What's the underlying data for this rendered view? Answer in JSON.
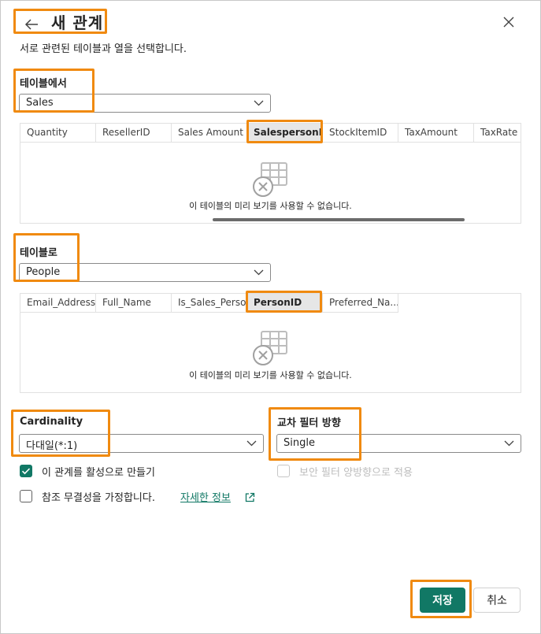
{
  "header": {
    "title": "새 관계",
    "subtitle": "서로 관련된 테이블과 열을 선택합니다."
  },
  "from_table": {
    "label": "테이블에서",
    "selected": "Sales",
    "columns": [
      "Quantity",
      "ResellerID",
      "Sales Amount",
      "SalespersonP...",
      "StockItemID",
      "TaxAmount",
      "TaxRate"
    ],
    "selected_column": "SalespersonP...",
    "empty_message": "이 테이블의 미리 보기를 사용할 수 없습니다."
  },
  "to_table": {
    "label": "테이블로",
    "selected": "People",
    "columns": [
      "Email_Address",
      "Full_Name",
      "Is_Sales_Person",
      "PersonID",
      "Preferred_Na..."
    ],
    "selected_column": "PersonID",
    "empty_message": "이 테이블의 미리 보기를 사용할 수 없습니다."
  },
  "cardinality": {
    "label": "Cardinality",
    "selected": "다대일(*:1)"
  },
  "cross_filter": {
    "label": "교차 필터 방향",
    "selected": "Single"
  },
  "options": {
    "make_active": {
      "label": "이 관계를 활성으로 만들기",
      "checked": true
    },
    "security_filter": {
      "label": "보안 필터 양방향으로 적용",
      "checked": false,
      "disabled": true
    },
    "referential_integrity": {
      "label": "참조 무결성을 가정합니다.",
      "checked": false,
      "link": "자세한 정보"
    }
  },
  "footer": {
    "save_label": "저장",
    "cancel_label": "취소"
  },
  "colors": {
    "accent": "#117865",
    "highlight": "#f08a10"
  }
}
